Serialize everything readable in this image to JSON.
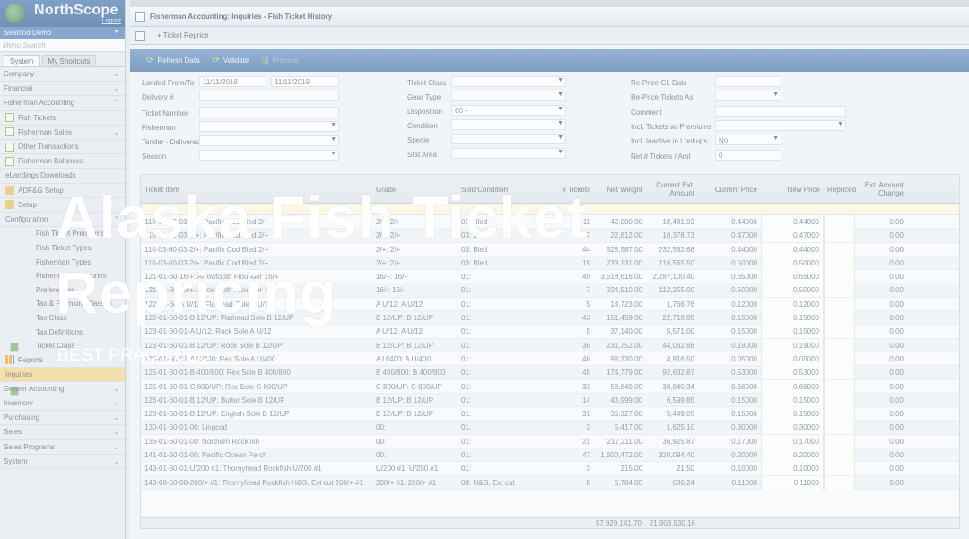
{
  "sidebar": {
    "brand": "NorthScope",
    "logout": "Logout",
    "company": "Seafood Demo",
    "search_placeholder": "Menu Search",
    "tabs": [
      "System",
      "My Shortcuts"
    ],
    "items": [
      {
        "label": "Company",
        "type": "group"
      },
      {
        "label": "Financial",
        "type": "group"
      },
      {
        "label": "Fisherman Accounting",
        "type": "group-open"
      },
      {
        "label": "Fish Tickets",
        "type": "sub",
        "icon": "doc-icon"
      },
      {
        "label": "Fisherman Sales",
        "type": "sub",
        "icon": "doc-icon"
      },
      {
        "label": "Other Transactions",
        "type": "sub",
        "icon": "doc-icon"
      },
      {
        "label": "Fisherman Balances",
        "type": "sub",
        "icon": "doc-icon"
      },
      {
        "label": "eLandings Downloads",
        "type": "sub",
        "icon": "grid-icon"
      },
      {
        "label": "ADF&G Setup",
        "type": "sub",
        "icon": "folder-icon"
      },
      {
        "label": "Setup",
        "type": "sub",
        "icon": "folder-icon"
      },
      {
        "label": "Configuration",
        "type": "sub-open",
        "icon": "grid-icon"
      },
      {
        "label": "Fish Ticket Premiums",
        "type": "sub2"
      },
      {
        "label": "Fish Ticket Types",
        "type": "sub2"
      },
      {
        "label": "Fisherman Types",
        "type": "sub2"
      },
      {
        "label": "Fisherman Categories",
        "type": "sub2"
      },
      {
        "label": "Preferences",
        "type": "sub2"
      },
      {
        "label": "Tax & Premium Classes",
        "type": "sub2"
      },
      {
        "label": "Tax Class",
        "type": "sub2"
      },
      {
        "label": "Tax Definitions",
        "type": "sub2"
      },
      {
        "label": "Ticket Class",
        "type": "sub2"
      },
      {
        "label": "Reports",
        "type": "sub",
        "icon": "bars-icon"
      },
      {
        "label": "Inquiries",
        "type": "selected"
      },
      {
        "label": "Grower Accounting",
        "type": "group"
      },
      {
        "label": "Inventory",
        "type": "group"
      },
      {
        "label": "Purchasing",
        "type": "group"
      },
      {
        "label": "Sales",
        "type": "group"
      },
      {
        "label": "Sales Programs",
        "type": "group"
      },
      {
        "label": "System",
        "type": "group"
      }
    ]
  },
  "main": {
    "window_title": "Fisherman Accounting: Inquiries - Fish Ticket History",
    "subwindow_title": "+ Ticket Reprice",
    "toolbar": {
      "refresh": "Refresh Data",
      "validate": "Validate",
      "process": "Process"
    },
    "filters": {
      "landed_label": "Landed From/To",
      "landed_from": "11/11/2018",
      "landed_to": "11/11/2019",
      "delivery_label": "Delivery #",
      "ticket_number_label": "Ticket Number",
      "fisherman_label": "Fisherman",
      "tender_label": "Tender - Delivered",
      "season_label": "Season",
      "ticket_class_label": "Ticket Class",
      "gear_type_label": "Gear Type",
      "disposition_label": "Disposition",
      "disposition_value": "60 -",
      "condition_label": "Condition",
      "specie_label": "Specie",
      "stat_area_label": "Stat Area",
      "reprice_gl_label": "Re-Price GL Date",
      "reprice_as_label": "Re-Price Tickets As",
      "comment_label": "Comment",
      "incl_premiums_label": "Incl. Tickets w/ Premiums",
      "incl_inactive_label": "Incl. Inactive in Lookups",
      "incl_inactive_value": "No",
      "net_label": "Net # Tickets / Amt",
      "net_value": "0"
    },
    "grid": {
      "headers": [
        "Ticket Item",
        "Grade",
        "Sold Condition",
        "# Tickets",
        "Net Weight",
        "Current Ext. Amount",
        "Current Price",
        "New Price",
        "Repriced",
        "Ext. Amount Change"
      ],
      "rows": [
        [
          "110-03-60-03-2/+: Pacific Cod Bled 2/+",
          "2/+: 2/+",
          "03: Bled",
          "11",
          "42,000.00",
          "18,481.92",
          "0.44000",
          "0.44000",
          "",
          "0.00"
        ],
        [
          "110-03-60-03-2/+: Pacific Cod Bled 2/+",
          "2/+: 2/+",
          "03: Bled",
          "7",
          "22,812.00",
          "10,378.73",
          "0.47000",
          "0.47000",
          "",
          "0.00"
        ],
        [
          "110-03-60-03-2/+: Pacific Cod Bled 2/+",
          "2/+: 2/+",
          "03: Bled",
          "44",
          "528,587.00",
          "232,582.68",
          "0.44000",
          "0.44000",
          "",
          "0.00"
        ],
        [
          "110-03-60-03-2/+: Pacific Cod Bled 2/+",
          "2/+: 2/+",
          "03: Bled",
          "15",
          "233,131.00",
          "116,565.50",
          "0.50000",
          "0.50000",
          "",
          "0.00"
        ],
        [
          "121-01-60-16/+: Arrowtooth Flounder 16/+",
          "16/+: 16/+",
          "01:",
          "49",
          "3,518,616.00",
          "2,287,100.40",
          "0.65000",
          "0.65000",
          "",
          "0.00"
        ],
        [
          "121-01-60-16/+: Arrowtooth Flounder 16/-",
          "16/-: 16/-",
          "01:",
          "7",
          "224,510.00",
          "112,255.00",
          "0.50000",
          "0.50000",
          "",
          "0.00"
        ],
        [
          "122-01-60-A U/12: Flathead Sole A U/12",
          "A U/12: A U/12",
          "01:",
          "5",
          "14,723.00",
          "1,766.76",
          "0.12000",
          "0.12000",
          "",
          "0.00"
        ],
        [
          "122-01-60-01-B 12/UP: Flathead Sole B 12/UP",
          "B 12/UP: B 12/UP",
          "01:",
          "43",
          "151,459.00",
          "22,718.85",
          "0.15000",
          "0.15000",
          "",
          "0.00"
        ],
        [
          "123-01-60-01-A U/12: Rock Sole A U/12",
          "A U/12: A U/12",
          "01:",
          "5",
          "37,140.00",
          "5,571.00",
          "0.15000",
          "0.15000",
          "",
          "0.00"
        ],
        [
          "123-01-60-01-B 12/UP: Rock Sole B 12/UP",
          "B 12/UP: B 12/UP",
          "01:",
          "36",
          "231,752.00",
          "44,032.88",
          "0.19000",
          "0.19000",
          "",
          "0.00"
        ],
        [
          "125-01-60-01-A U/400: Rex Sole A U/400",
          "A U/400: A U/400",
          "01:",
          "46",
          "98,330.00",
          "4,916.50",
          "0.05000",
          "0.05000",
          "",
          "0.00"
        ],
        [
          "125-01-60-01-B 400/800: Rex Sole B 400/800",
          "B 400/800: B 400/800",
          "01:",
          "45",
          "174,779.00",
          "92,632.87",
          "0.53000",
          "0.53000",
          "",
          "0.00"
        ],
        [
          "125-01-60-01-C 800/UP: Rex Sole C 800/UP",
          "C 800/UP: C 800/UP",
          "01:",
          "33",
          "58,849.00",
          "38,840.34",
          "0.66000",
          "0.66000",
          "",
          "0.00"
        ],
        [
          "126-01-60-01-B 12/UP: Butter Sole B 12/UP",
          "B 12/UP: B 12/UP",
          "01:",
          "14",
          "43,999.00",
          "6,599.85",
          "0.15000",
          "0.15000",
          "",
          "0.00"
        ],
        [
          "128-01-60-01-B 12/UP: English Sole B 12/UP",
          "B 12/UP: B 12/UP",
          "01:",
          "31",
          "36,327.00",
          "5,449.05",
          "0.15000",
          "0.15000",
          "",
          "0.00"
        ],
        [
          "130-01-60-01-00: Lingcod",
          "00:",
          "01:",
          "3",
          "5,417.00",
          "1,625.10",
          "0.30000",
          "0.30000",
          "",
          "0.00"
        ],
        [
          "136-01-60-01-00: Northern Rockfish",
          "00:",
          "01:",
          "21",
          "217,211.00",
          "36,925.87",
          "0.17000",
          "0.17000",
          "",
          "0.00"
        ],
        [
          "141-01-60-01-00: Pacific Ocean Perch",
          "00:",
          "01:",
          "47",
          "1,600,472.00",
          "320,094.40",
          "0.20000",
          "0.20000",
          "",
          "0.00"
        ],
        [
          "143-01-60-01-U/200 #1: Thornyhead Rockfish U/200 #1",
          "U/200 #1: U/200 #1",
          "01:",
          "3",
          "215.00",
          "21.50",
          "0.10000",
          "0.10000",
          "",
          "0.00"
        ],
        [
          "143-08-60-08-200/+ #1: Thornyhead Rockfish H&G, Ext cut 200/+ #1",
          "200/+ #1: 200/+ #1",
          "08: H&G, Ext cut",
          "8",
          "5,784.00",
          "636.24",
          "0.11000",
          "0.11000",
          "",
          "0.00"
        ]
      ],
      "total_weight": "57,929,141.70",
      "total_amount": "21,903,930.16"
    }
  },
  "overlay": {
    "title_line1": "Alaska Fish Ticket",
    "title_line2": "Repricing",
    "subtitle": "BEST PRACTICES"
  }
}
